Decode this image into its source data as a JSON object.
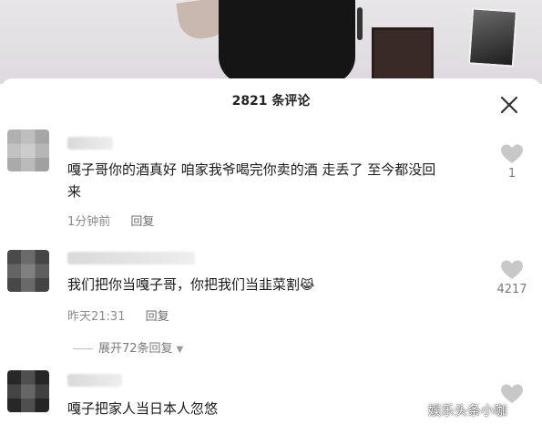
{
  "header": {
    "title": "2821 条评论",
    "close_icon": "close-icon"
  },
  "comments": [
    {
      "text_line1": "嘎子哥你的酒真好 咱家我爷喝完你卖的酒 走丢了 至今都没回",
      "text_line2": "来",
      "time": "1分钟前",
      "reply_label": "回复",
      "likes": "1"
    },
    {
      "text": "我们把你当嘎子哥，你把我们当韭菜割",
      "emoji": "😹",
      "time": "昨天21:31",
      "reply_label": "回复",
      "likes": "4217",
      "expand_label": "展开72条回复"
    },
    {
      "text": "嘎子把家人当日本人忽悠",
      "likes": ""
    }
  ],
  "watermark": "娱乐头条小咖",
  "colors": {
    "meta_text": "#8c8c8c",
    "like_icon": "#c8c8c8"
  }
}
